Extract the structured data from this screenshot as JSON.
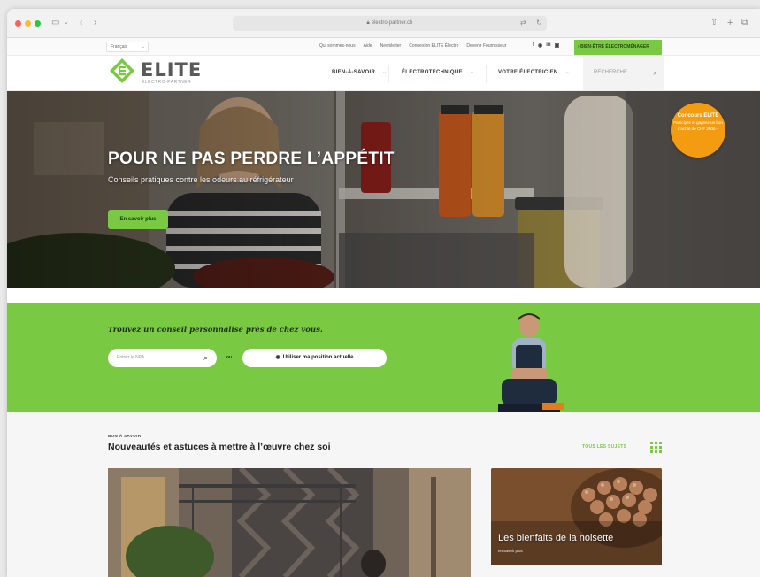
{
  "browser": {
    "url": "electro-partner.ch"
  },
  "utility_bar": {
    "language": "Français",
    "links": [
      "Qui sommes-nous",
      "Aide",
      "Newsletter",
      "Connexion ELITE Électro",
      "Devenir Fournisseur"
    ],
    "social": [
      "f",
      "◉",
      "in",
      "▣"
    ],
    "cta_label": "BIEN-ÊTRE ÉLECTROMÉNAGER"
  },
  "header": {
    "logo_text": "ELITE",
    "logo_sub": "ÉLECTRO-PARTNER",
    "nav": [
      {
        "label": "BIEN-À-SAVOIR"
      },
      {
        "label": "ÉLECTROTECHNIQUE"
      },
      {
        "label": "VOTRE ÉLECTRICIEN"
      }
    ],
    "search_placeholder": "RECHERCHE"
  },
  "hero": {
    "title": "POUR NE PAS PERDRE L’APPÉTIT",
    "subtitle": "Conseils pratiques contre les odeurs au réfrigérateur",
    "button_label": "En savoir plus",
    "badge_title": "Concours ELITE",
    "badge_text": "Participez et gagnez un bon d’achat de CHF 3000.–"
  },
  "finder": {
    "title": "Trouvez un conseil personnalisé près de chez vous.",
    "zip_placeholder": "Entrez le NPA",
    "or_label": "ou",
    "position_label": "Utiliser ma position actuelle"
  },
  "news": {
    "eyebrow": "BON À SAVOIR",
    "title": "Nouveautés et astuces à mettre à l’œuvre chez soi",
    "all_label": "TOUS LES SUJETS",
    "card_small_title": "Les bienfaits de la noisette",
    "card_small_meta": "en savoir plus"
  },
  "colors": {
    "brand_green": "#7ac943",
    "badge_orange": "#f39c12"
  }
}
